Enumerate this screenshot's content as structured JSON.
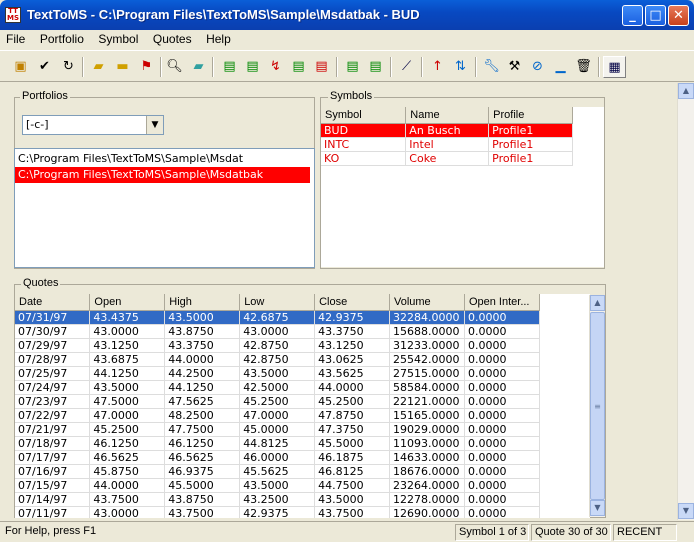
{
  "window": {
    "title": "TextToMS - C:\\Program Files\\TextToMS\\Sample\\Msdatbak - BUD",
    "icon_text": "TextToMS"
  },
  "menu": [
    "File",
    "Portfolio",
    "Symbol",
    "Quotes",
    "Help"
  ],
  "toolbar_icons": [
    "open-folder-icon",
    "check-icon",
    "refresh-icon",
    "add-folder-icon",
    "folder-icon",
    "folder-flag-icon",
    "magnifier-icon",
    "eraser-icon",
    "add-symbol-icon",
    "remove-symbol-icon",
    "edit-symbol-icon",
    "symbol-icon",
    "symbol-red-icon",
    "find-symbol-icon",
    "symbol-next-icon",
    "chart-icon",
    "up-arrow-icon",
    "swap-icon",
    "wrench-icon",
    "hammer-icon",
    "no-entry-icon",
    "lamp-icon",
    "trash-icon",
    "grid-icon"
  ],
  "portfolios": {
    "label": "Portfolios",
    "drive": "[-c-]",
    "paths": [
      "C:\\Program Files\\TextToMS\\Sample\\Msdat",
      "C:\\Program Files\\TextToMS\\Sample\\Msdatbak"
    ]
  },
  "symbols": {
    "label": "Symbols",
    "columns": [
      "Symbol",
      "Name",
      "Profile"
    ],
    "rows": [
      [
        "BUD",
        "An Busch",
        "Profile1"
      ],
      [
        "INTC",
        "Intel",
        "Profile1"
      ],
      [
        "KO",
        "Coke",
        "Profile1"
      ]
    ]
  },
  "quotes": {
    "label": "Quotes",
    "columns": [
      "Date",
      "Open",
      "High",
      "Low",
      "Close",
      "Volume",
      "Open Inter..."
    ],
    "rows": [
      [
        "07/31/97",
        "43.4375",
        "43.5000",
        "42.6875",
        "42.9375",
        "32284.0000",
        "0.0000"
      ],
      [
        "07/30/97",
        "43.0000",
        "43.8750",
        "43.0000",
        "43.3750",
        "15688.0000",
        "0.0000"
      ],
      [
        "07/29/97",
        "43.1250",
        "43.3750",
        "42.8750",
        "43.1250",
        "31233.0000",
        "0.0000"
      ],
      [
        "07/28/97",
        "43.6875",
        "44.0000",
        "42.8750",
        "43.0625",
        "25542.0000",
        "0.0000"
      ],
      [
        "07/25/97",
        "44.1250",
        "44.2500",
        "43.5000",
        "43.5625",
        "27515.0000",
        "0.0000"
      ],
      [
        "07/24/97",
        "43.5000",
        "44.1250",
        "42.5000",
        "44.0000",
        "58584.0000",
        "0.0000"
      ],
      [
        "07/23/97",
        "47.5000",
        "47.5625",
        "45.2500",
        "45.2500",
        "22121.0000",
        "0.0000"
      ],
      [
        "07/22/97",
        "47.0000",
        "48.2500",
        "47.0000",
        "47.8750",
        "15165.0000",
        "0.0000"
      ],
      [
        "07/21/97",
        "45.2500",
        "47.7500",
        "45.0000",
        "47.3750",
        "19029.0000",
        "0.0000"
      ],
      [
        "07/18/97",
        "46.1250",
        "46.1250",
        "44.8125",
        "45.5000",
        "11093.0000",
        "0.0000"
      ],
      [
        "07/17/97",
        "46.5625",
        "46.5625",
        "46.0000",
        "46.1875",
        "14633.0000",
        "0.0000"
      ],
      [
        "07/16/97",
        "45.8750",
        "46.9375",
        "45.5625",
        "46.8125",
        "18676.0000",
        "0.0000"
      ],
      [
        "07/15/97",
        "44.0000",
        "45.5000",
        "43.5000",
        "44.7500",
        "23264.0000",
        "0.0000"
      ],
      [
        "07/14/97",
        "43.7500",
        "43.8750",
        "43.2500",
        "43.5000",
        "12278.0000",
        "0.0000"
      ],
      [
        "07/11/97",
        "43.0000",
        "43.7500",
        "42.9375",
        "43.7500",
        "12690.0000",
        "0.0000"
      ]
    ]
  },
  "status": {
    "help": "For Help, press F1",
    "symbol": "Symbol 1 of 3",
    "quote": "Quote 30 of 30",
    "mode": "RECENT"
  }
}
